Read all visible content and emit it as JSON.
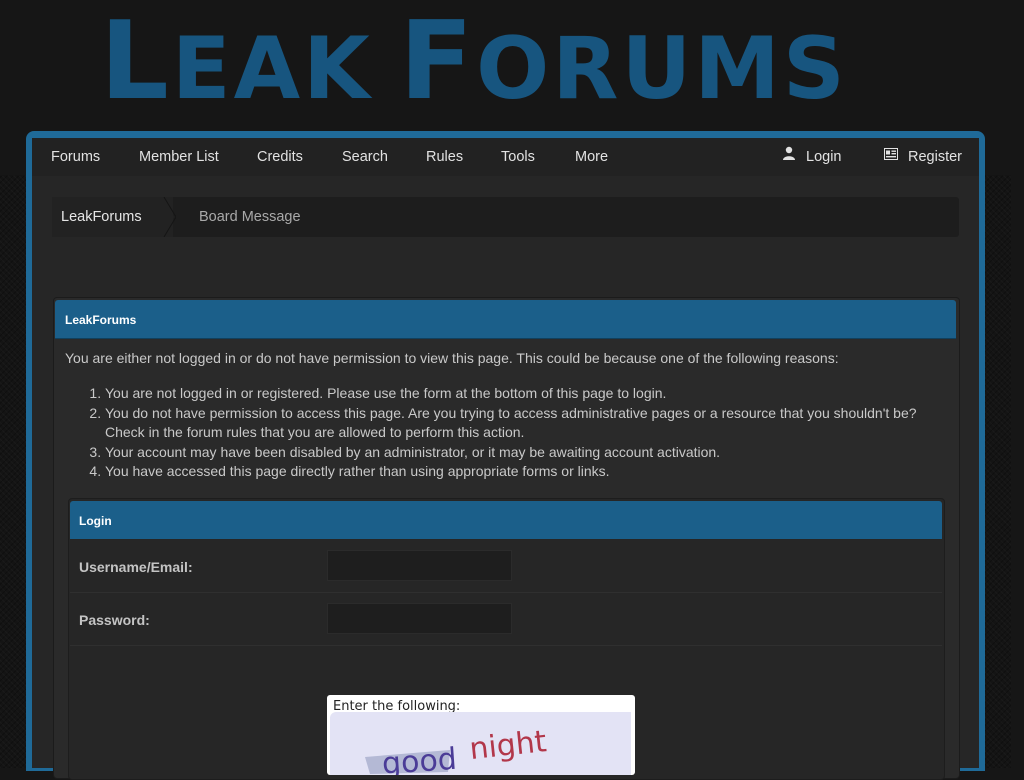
{
  "logo": {
    "L": "L",
    "eak": "EAK",
    "F": "F",
    "orums": "ORUMS"
  },
  "nav": {
    "items": [
      "Forums",
      "Member List",
      "Credits",
      "Search",
      "Rules",
      "Tools",
      "More"
    ],
    "login": "Login",
    "register": "Register"
  },
  "breadcrumb": {
    "home": "LeakForums",
    "current": "Board Message"
  },
  "panel": {
    "title": "LeakForums",
    "intro": "You are either not logged in or do not have permission to view this page. This could be because one of the following reasons:",
    "reasons": [
      "You are not logged in or registered. Please use the form at the bottom of this page to login.",
      "You do not have permission to access this page. Are you trying to access administrative pages or a resource that you shouldn't be? Check in the forum rules that you are allowed to perform this action.",
      "Your account may have been disabled by an administrator, or it may be awaiting account activation.",
      "You have accessed this page directly rather than using appropriate forms or links."
    ]
  },
  "login": {
    "title": "Login",
    "username_label": "Username/Email:",
    "password_label": "Password:",
    "username_value": "",
    "password_value": "",
    "captcha_label": "Enter the following:",
    "captcha_words": [
      "good",
      "night"
    ]
  },
  "colors": {
    "accent": "#1b5f8a",
    "logo": "#17557f",
    "frame": "#1f6a98"
  }
}
